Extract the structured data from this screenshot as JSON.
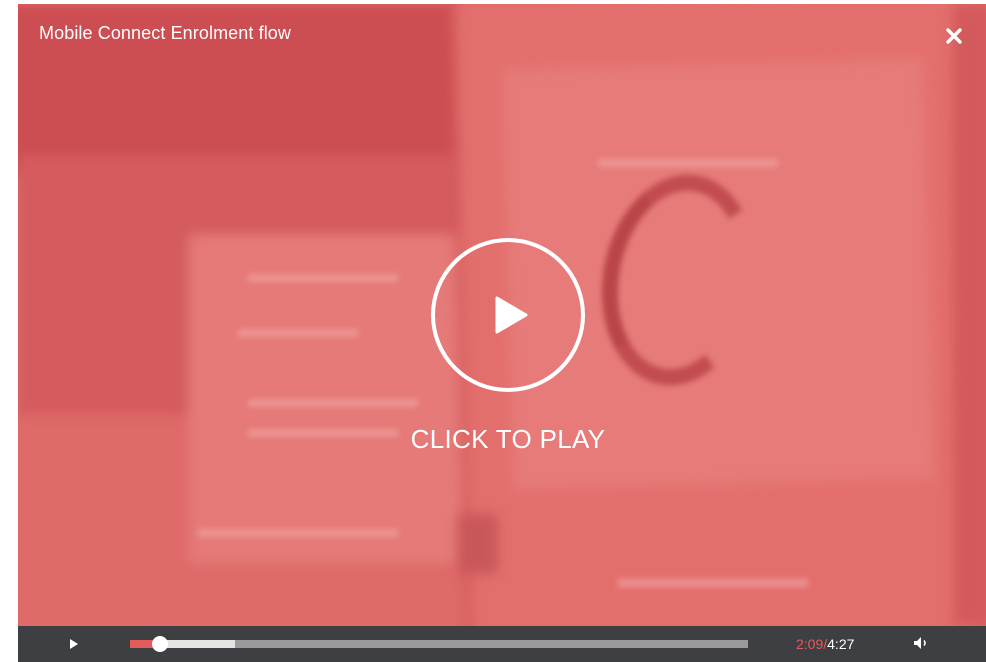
{
  "player": {
    "title": "Mobile Connect Enrolment flow",
    "overlay_color": "#de6a69",
    "accent_color": "#e35c5b",
    "controlbar_color": "#3e3f42"
  },
  "overlay": {
    "cta_label": "CLICK TO PLAY",
    "play_icon": "play-circle-icon",
    "close_icon": "close-icon"
  },
  "controls": {
    "play_icon": "play-icon",
    "volume_icon": "volume-icon",
    "time_current": "2:09",
    "time_separator": "/",
    "time_duration": "4:27",
    "progress_played_fraction": 0.048,
    "progress_buffered_fraction": 0.17
  }
}
